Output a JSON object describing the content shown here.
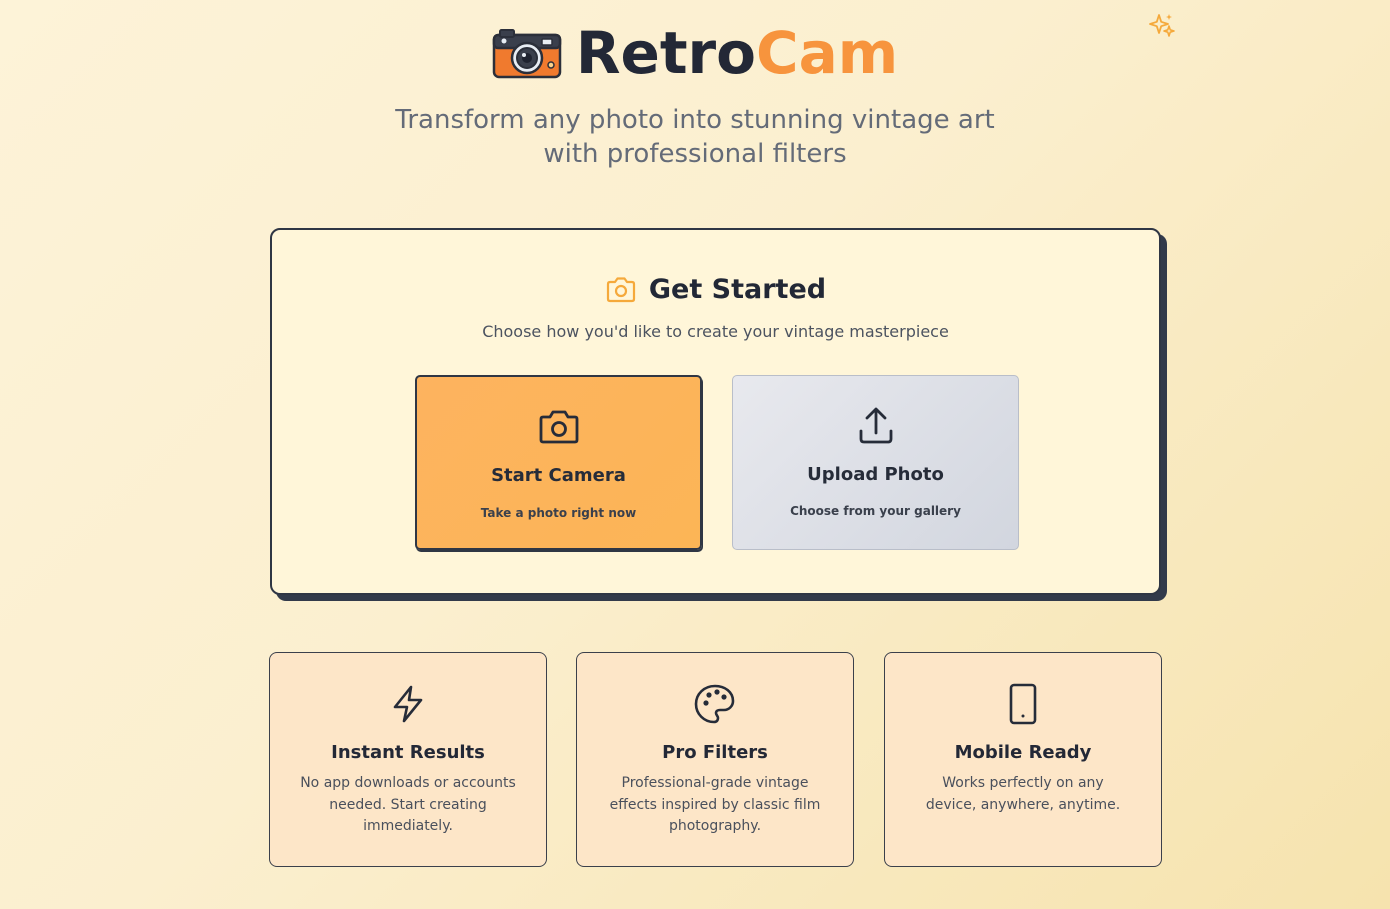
{
  "header": {
    "brand_part1": "Retro",
    "brand_part2": "Cam",
    "tagline_line1": "Transform any photo into stunning vintage art",
    "tagline_line2": "with professional filters"
  },
  "get_started": {
    "title": "Get Started",
    "subtitle": "Choose how you'd like to create your vintage masterpiece",
    "options": [
      {
        "label": "Start Camera",
        "description": "Take a photo right now",
        "icon": "camera-icon"
      },
      {
        "label": "Upload Photo",
        "description": "Choose from your gallery",
        "icon": "upload-icon"
      }
    ]
  },
  "features": [
    {
      "title": "Instant Results",
      "description": "No app downloads or accounts needed. Start creating immediately.",
      "icon": "lightning-icon"
    },
    {
      "title": "Pro Filters",
      "description": "Professional-grade vintage effects inspired by classic film photography.",
      "icon": "palette-icon"
    },
    {
      "title": "Mobile Ready",
      "description": "Works perfectly on any device, anywhere, anytime.",
      "icon": "tablet-icon"
    }
  ],
  "colors": {
    "accent": "#f7943d",
    "primary_dark": "#232836",
    "camera_button": "#fdb35f",
    "upload_button": "#d9dce3",
    "feature_card": "#fde6c8",
    "panel": "#fff6d9"
  }
}
